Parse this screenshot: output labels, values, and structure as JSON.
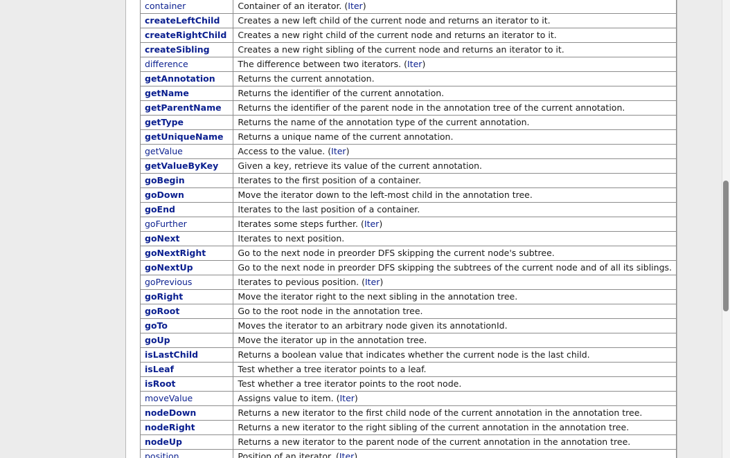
{
  "rows": [
    {
      "name": "container",
      "bold": false,
      "desc": "Container of an iterator. ",
      "inherited": "Iter"
    },
    {
      "name": "createLeftChild",
      "bold": true,
      "desc": "Creates a new left child of the current node and returns an iterator to it."
    },
    {
      "name": "createRightChild",
      "bold": true,
      "desc": "Creates a new right child of the current node and returns an iterator to it."
    },
    {
      "name": "createSibling",
      "bold": true,
      "desc": "Creates a new right sibling of the current node and returns an iterator to it."
    },
    {
      "name": "difference",
      "bold": false,
      "desc": "The difference between two iterators. ",
      "inherited": "Iter"
    },
    {
      "name": "getAnnotation",
      "bold": true,
      "desc": "Returns the current annotation."
    },
    {
      "name": "getName",
      "bold": true,
      "desc": "Returns the identifier of the current annotation."
    },
    {
      "name": "getParentName",
      "bold": true,
      "desc": "Returns the identifier of the parent node in the annotation tree of the current annotation."
    },
    {
      "name": "getType",
      "bold": true,
      "desc": "Returns the name of the annotation type of the current annotation."
    },
    {
      "name": "getUniqueName",
      "bold": true,
      "desc": "Returns a unique name of the current annotation."
    },
    {
      "name": "getValue",
      "bold": false,
      "desc": "Access to the value. ",
      "inherited": "Iter"
    },
    {
      "name": "getValueByKey",
      "bold": true,
      "desc": "Given a key, retrieve its value of the current annotation."
    },
    {
      "name": "goBegin",
      "bold": true,
      "desc": "Iterates to the first position of a container."
    },
    {
      "name": "goDown",
      "bold": true,
      "desc": "Move the iterator down to the left-most child in the annotation tree."
    },
    {
      "name": "goEnd",
      "bold": true,
      "desc": "Iterates to the last position of a container."
    },
    {
      "name": "goFurther",
      "bold": false,
      "desc": "Iterates some steps further. ",
      "inherited": "Iter"
    },
    {
      "name": "goNext",
      "bold": true,
      "desc": "Iterates to next position."
    },
    {
      "name": "goNextRight",
      "bold": true,
      "desc": "Go to the next node in preorder DFS skipping the current node's subtree."
    },
    {
      "name": "goNextUp",
      "bold": true,
      "desc": "Go to the next node in preorder DFS skipping the subtrees of the current node and of all its siblings."
    },
    {
      "name": "goPrevious",
      "bold": false,
      "desc": "Iterates to pevious position. ",
      "inherited": "Iter"
    },
    {
      "name": "goRight",
      "bold": true,
      "desc": "Move the iterator right to the next sibling in the annotation tree."
    },
    {
      "name": "goRoot",
      "bold": true,
      "desc": "Go to the root node in the annotation tree."
    },
    {
      "name": "goTo",
      "bold": true,
      "desc": "Moves the iterator to an arbitrary node given its annotationId."
    },
    {
      "name": "goUp",
      "bold": true,
      "desc": "Move the iterator up in the annotation tree."
    },
    {
      "name": "isLastChild",
      "bold": true,
      "desc": "Returns a boolean value that indicates whether the current node is the last child."
    },
    {
      "name": "isLeaf",
      "bold": true,
      "desc": "Test whether a tree iterator points to a leaf."
    },
    {
      "name": "isRoot",
      "bold": true,
      "desc": "Test whether a tree iterator points to the root node."
    },
    {
      "name": "moveValue",
      "bold": false,
      "desc": "Assigns value to item. ",
      "inherited": "Iter"
    },
    {
      "name": "nodeDown",
      "bold": true,
      "desc": "Returns a new iterator to the first child node of the current annotation in the annotation tree."
    },
    {
      "name": "nodeRight",
      "bold": true,
      "desc": "Returns a new iterator to the right sibling of the current annotation in the annotation tree."
    },
    {
      "name": "nodeUp",
      "bold": true,
      "desc": "Returns a new iterator to the parent node of the current annotation in the annotation tree."
    },
    {
      "name": "position",
      "bold": false,
      "desc": "Position of an iterator. ",
      "inherited": "Iter"
    }
  ]
}
